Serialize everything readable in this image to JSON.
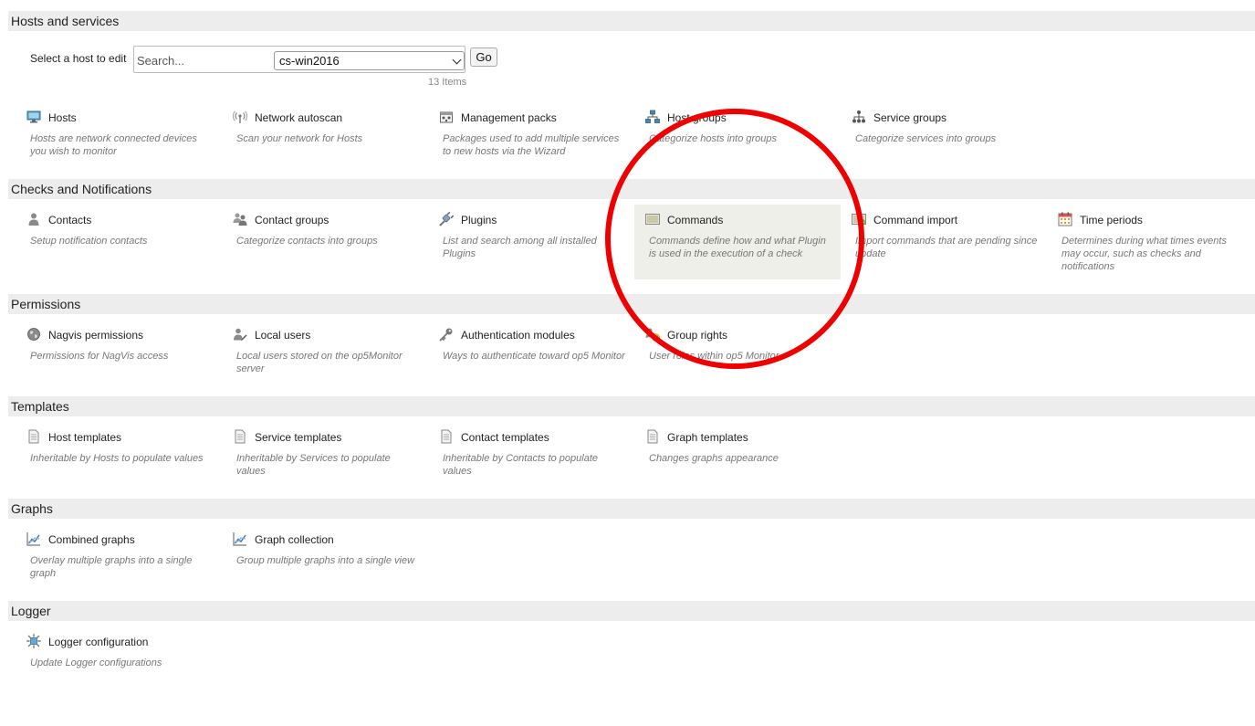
{
  "sections": [
    {
      "title": "Hosts and services",
      "host_select": {
        "label": "Select a host to edit",
        "search_placeholder": "Search...",
        "selected_host": "cs-win2016",
        "go_label": "Go",
        "items_count": "13 Items"
      },
      "tiles": [
        {
          "title": "Hosts",
          "desc": "Hosts are network connected devices you wish to monitor",
          "icon": "monitor-icon"
        },
        {
          "title": "Network autoscan",
          "desc": "Scan your network for Hosts",
          "icon": "antenna-icon"
        },
        {
          "title": "Management packs",
          "desc": "Packages used to add multiple services to new hosts via the Wizard",
          "icon": "package-icon"
        },
        {
          "title": "Host groups",
          "desc": "Categorize hosts into groups",
          "icon": "host-groups-icon"
        },
        {
          "title": "Service groups",
          "desc": "Categorize services into groups",
          "icon": "service-groups-icon"
        }
      ]
    },
    {
      "title": "Checks and Notifications",
      "tiles": [
        {
          "title": "Contacts",
          "desc": "Setup notification contacts",
          "icon": "person-icon"
        },
        {
          "title": "Contact groups",
          "desc": "Categorize contacts into groups",
          "icon": "people-icon"
        },
        {
          "title": "Plugins",
          "desc": "List and search among all installed Plugins",
          "icon": "plug-icon"
        },
        {
          "title": "Commands",
          "desc": "Commands define how and what Plugin is used in the execution of a check",
          "icon": "terminal-icon"
        },
        {
          "title": "Command import",
          "desc": "Import commands that are pending since update",
          "icon": "import-icon"
        },
        {
          "title": "Time periods",
          "desc": "Determines during what times events may occur, such as checks and notifications",
          "icon": "calendar-icon"
        }
      ]
    },
    {
      "title": "Permissions",
      "tiles": [
        {
          "title": "Nagvis permissions",
          "desc": "Permissions for NagVis access",
          "icon": "globe-icon"
        },
        {
          "title": "Local users",
          "desc": "Local users stored on the op5Monitor server",
          "icon": "user-edit-icon"
        },
        {
          "title": "Authentication modules",
          "desc": "Ways to authenticate toward op5 Monitor",
          "icon": "key-icon"
        },
        {
          "title": "Group rights",
          "desc": "User roles within op5 Monitor",
          "icon": "group-rights-icon"
        }
      ]
    },
    {
      "title": "Templates",
      "tiles": [
        {
          "title": "Host templates",
          "desc": "Inheritable by Hosts to populate values",
          "icon": "document-icon"
        },
        {
          "title": "Service templates",
          "desc": "Inheritable by Services to populate values",
          "icon": "document-icon"
        },
        {
          "title": "Contact templates",
          "desc": "Inheritable by Contacts to populate values",
          "icon": "document-icon"
        },
        {
          "title": "Graph templates",
          "desc": "Changes graphs appearance",
          "icon": "document-icon"
        }
      ]
    },
    {
      "title": "Graphs",
      "tiles": [
        {
          "title": "Combined graphs",
          "desc": "Overlay multiple graphs into a single graph",
          "icon": "line-graph-icon"
        },
        {
          "title": "Graph collection",
          "desc": "Group multiple graphs into a single view",
          "icon": "line-graph-icon"
        }
      ]
    },
    {
      "title": "Logger",
      "tiles": [
        {
          "title": "Logger configuration",
          "desc": "Update Logger configurations",
          "icon": "logger-gear-icon"
        }
      ]
    }
  ],
  "annotation": {
    "color": "#ee0000",
    "shape": "circle",
    "target": "Commands"
  },
  "colors": {
    "header_bg": "#ededed",
    "highlight_bg": "#efefea",
    "desc_text": "#777777"
  }
}
